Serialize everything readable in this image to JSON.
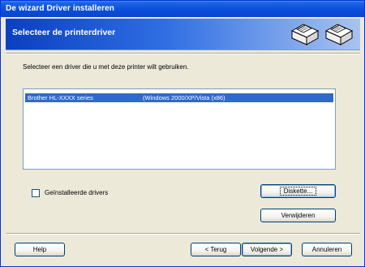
{
  "window": {
    "title": "De wizard Driver installeren"
  },
  "header": {
    "title": "Selecteer de printerdriver",
    "icon_names": [
      "printer-icon",
      "printer-icon"
    ]
  },
  "instruction": "Selecteer een driver die u met deze printer wilt gebruiken.",
  "driver_list": {
    "items": [
      {
        "name": "Brother HL-XXXX series",
        "platform": "(Windows 2000/XP/Vista (x86)",
        "selected": true
      }
    ]
  },
  "options": {
    "installed_drivers_label": "Geïnstalleerde drivers",
    "installed_drivers_checked": false
  },
  "buttons": {
    "diskette": "Diskette...",
    "remove": "Verwijderen",
    "help": "Help",
    "back": "< Terug",
    "next": "Volgende >",
    "cancel": "Annuleren"
  },
  "colors": {
    "selection": "#316ac5",
    "titlebar": "#0a4fdc",
    "dialog_bg": "#ece9d8"
  }
}
